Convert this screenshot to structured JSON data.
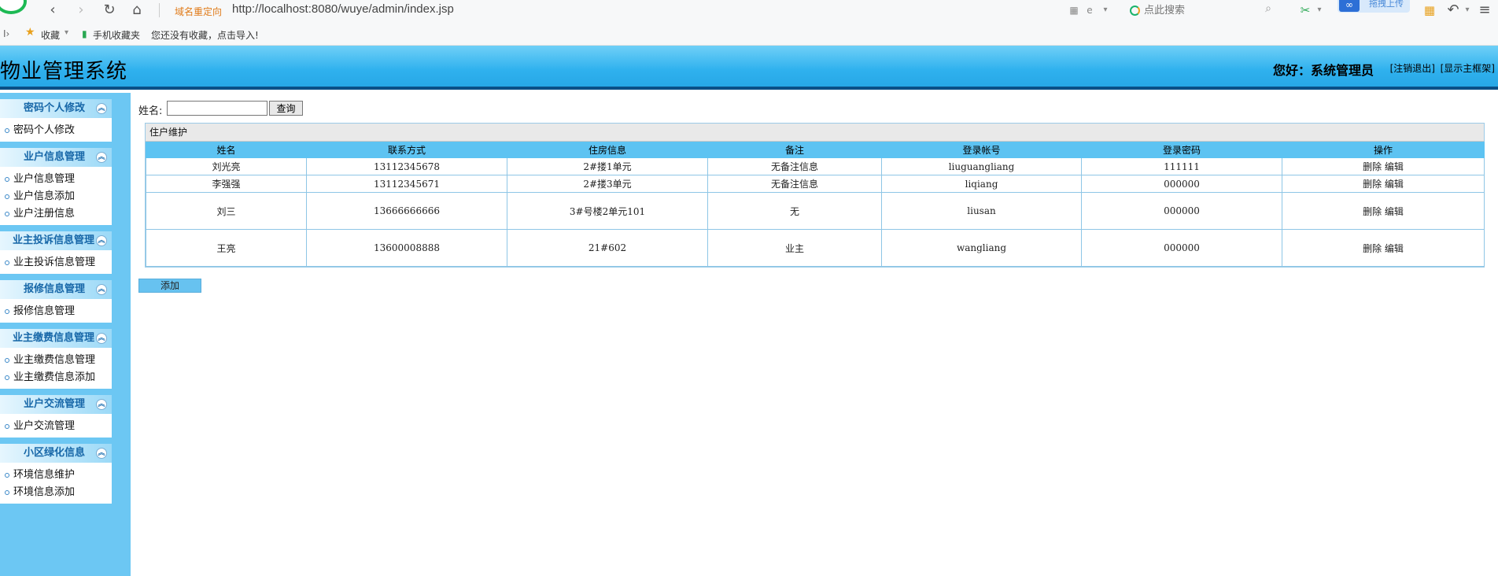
{
  "browser": {
    "redirect_label": "域名重定向",
    "url": "http://localhost:8080/wuye/admin/index.jsp",
    "search_placeholder": "点此搜索",
    "upload_label": "拖拽上传",
    "bookmarks": {
      "favorites": "收藏",
      "mobile": "手机收藏夹",
      "import_hint": "您还没有收藏，点击导入!"
    }
  },
  "app": {
    "title": "物业管理系统",
    "greeting": "您好：系统管理员",
    "logout": "[注销退出]",
    "show_frame": "[显示主框架]"
  },
  "sidebar": {
    "groups": [
      {
        "title": "密码个人修改",
        "items": [
          "密码个人修改"
        ]
      },
      {
        "title": "业户信息管理",
        "items": [
          "业户信息管理",
          "业户信息添加",
          "业户注册信息"
        ]
      },
      {
        "title": "业主投诉信息管理",
        "items": [
          "业主投诉信息管理"
        ]
      },
      {
        "title": "报修信息管理",
        "items": [
          "报修信息管理"
        ]
      },
      {
        "title": "业主缴费信息管理",
        "items": [
          "业主缴费信息管理",
          "业主缴费信息添加"
        ]
      },
      {
        "title": "业户交流管理",
        "items": [
          "业户交流管理"
        ]
      },
      {
        "title": "小区绿化信息",
        "items": [
          "环境信息维护",
          "环境信息添加"
        ]
      }
    ]
  },
  "search": {
    "label": "姓名:",
    "value": "",
    "button": "查询"
  },
  "table": {
    "caption": "住户维护",
    "headers": [
      "姓名",
      "联系方式",
      "住房信息",
      "备注",
      "登录帐号",
      "登录密码",
      "操作"
    ],
    "rows": [
      [
        "刘光亮",
        "13112345678",
        "2#搂1单元",
        "无备注信息",
        "liuguangliang",
        "111111"
      ],
      [
        "李强强",
        "13112345671",
        "2#搂3单元",
        "无备注信息",
        "liqiang",
        "000000"
      ],
      [
        "刘三",
        "13666666666",
        "3#号楼2单元101",
        "无",
        "liusan",
        "000000"
      ],
      [
        "王亮",
        "13600008888",
        "21#602",
        "业主",
        "wangliang",
        "000000"
      ]
    ],
    "delete_label": "删除",
    "edit_label": "编辑"
  },
  "add_button": "添加"
}
